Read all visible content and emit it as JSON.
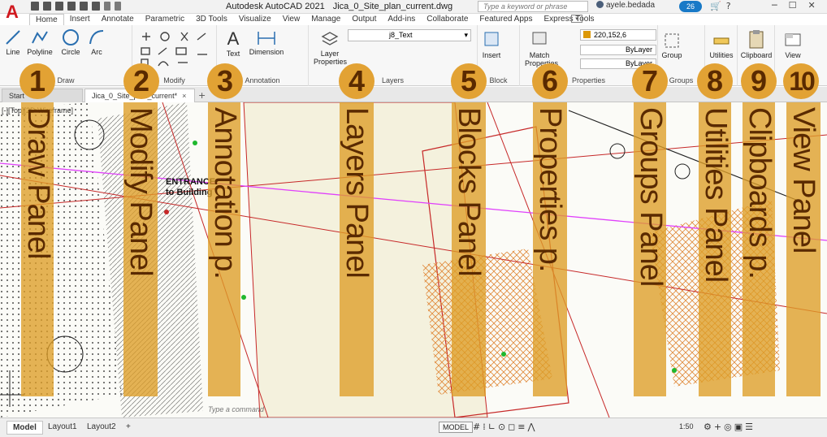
{
  "app": {
    "logo": "A",
    "title": "Autodesk AutoCAD 2021",
    "document": "Jica_0_Site_plan_current.dwg",
    "search_placeholder": "Type a keyword or phrase",
    "user": "ayele.bedada",
    "clock_badge": "26"
  },
  "ribbon_tabs": [
    "Home",
    "Insert",
    "Annotate",
    "Parametric",
    "3D Tools",
    "Visualize",
    "View",
    "Manage",
    "Output",
    "Add-ins",
    "Collaborate",
    "Featured Apps",
    "Express Tools"
  ],
  "ribbon": {
    "draw": {
      "label": "Draw",
      "tools": [
        "Line",
        "Polyline",
        "Circle",
        "Arc"
      ]
    },
    "modify": {
      "label": "Modify"
    },
    "annotation": {
      "label": "Annotation",
      "tools": [
        "Text",
        "Dimension"
      ]
    },
    "layers": {
      "label": "Layers",
      "tool": "Layer Properties",
      "layer_name": "j8_Text"
    },
    "block": {
      "label": "Block",
      "tool": "Insert"
    },
    "properties": {
      "label": "Properties",
      "tool": "Match Properties",
      "color": "220,152,6",
      "linetype": "ByLayer",
      "lineweight": "ByLayer"
    },
    "groups": {
      "label": "Groups",
      "tool": "Group"
    },
    "utilities": {
      "label": "Utilities"
    },
    "clipboard": {
      "label": "Clipboard"
    },
    "view": {
      "label": "View"
    }
  },
  "doc_tabs": {
    "start": "Start",
    "active": "Jica_0_Site_plan_current*",
    "close": "×",
    "plus": "+"
  },
  "canvas": {
    "view_label": "[-][Top][2D Wireframe]",
    "entrance_line1": "ENTRANCE",
    "entrance_line2": "to Building",
    "command_placeholder": "Type a command"
  },
  "overlays": [
    {
      "num": "1",
      "label": "Draw Panel"
    },
    {
      "num": "2",
      "label": "Modify Panel"
    },
    {
      "num": "3",
      "label": "Annotation p."
    },
    {
      "num": "4",
      "label": "Layers Panel"
    },
    {
      "num": "5",
      "label": "Blocks Panel"
    },
    {
      "num": "6",
      "label": "Properties p."
    },
    {
      "num": "7",
      "label": "Groups Panel"
    },
    {
      "num": "8",
      "label": "Utilities Panel"
    },
    {
      "num": "9",
      "label": "Clipboards p."
    },
    {
      "num": "10",
      "label": "View Panel"
    }
  ],
  "status": {
    "layouts": [
      "Model",
      "Layout1",
      "Layout2"
    ],
    "plus": "+",
    "model_button": "MODEL",
    "scale": "1:50"
  },
  "colors": {
    "overlay": "#de9e26",
    "overlay_text": "#5a2a00",
    "accent": "#1879c7",
    "logo": "#d0191f"
  }
}
